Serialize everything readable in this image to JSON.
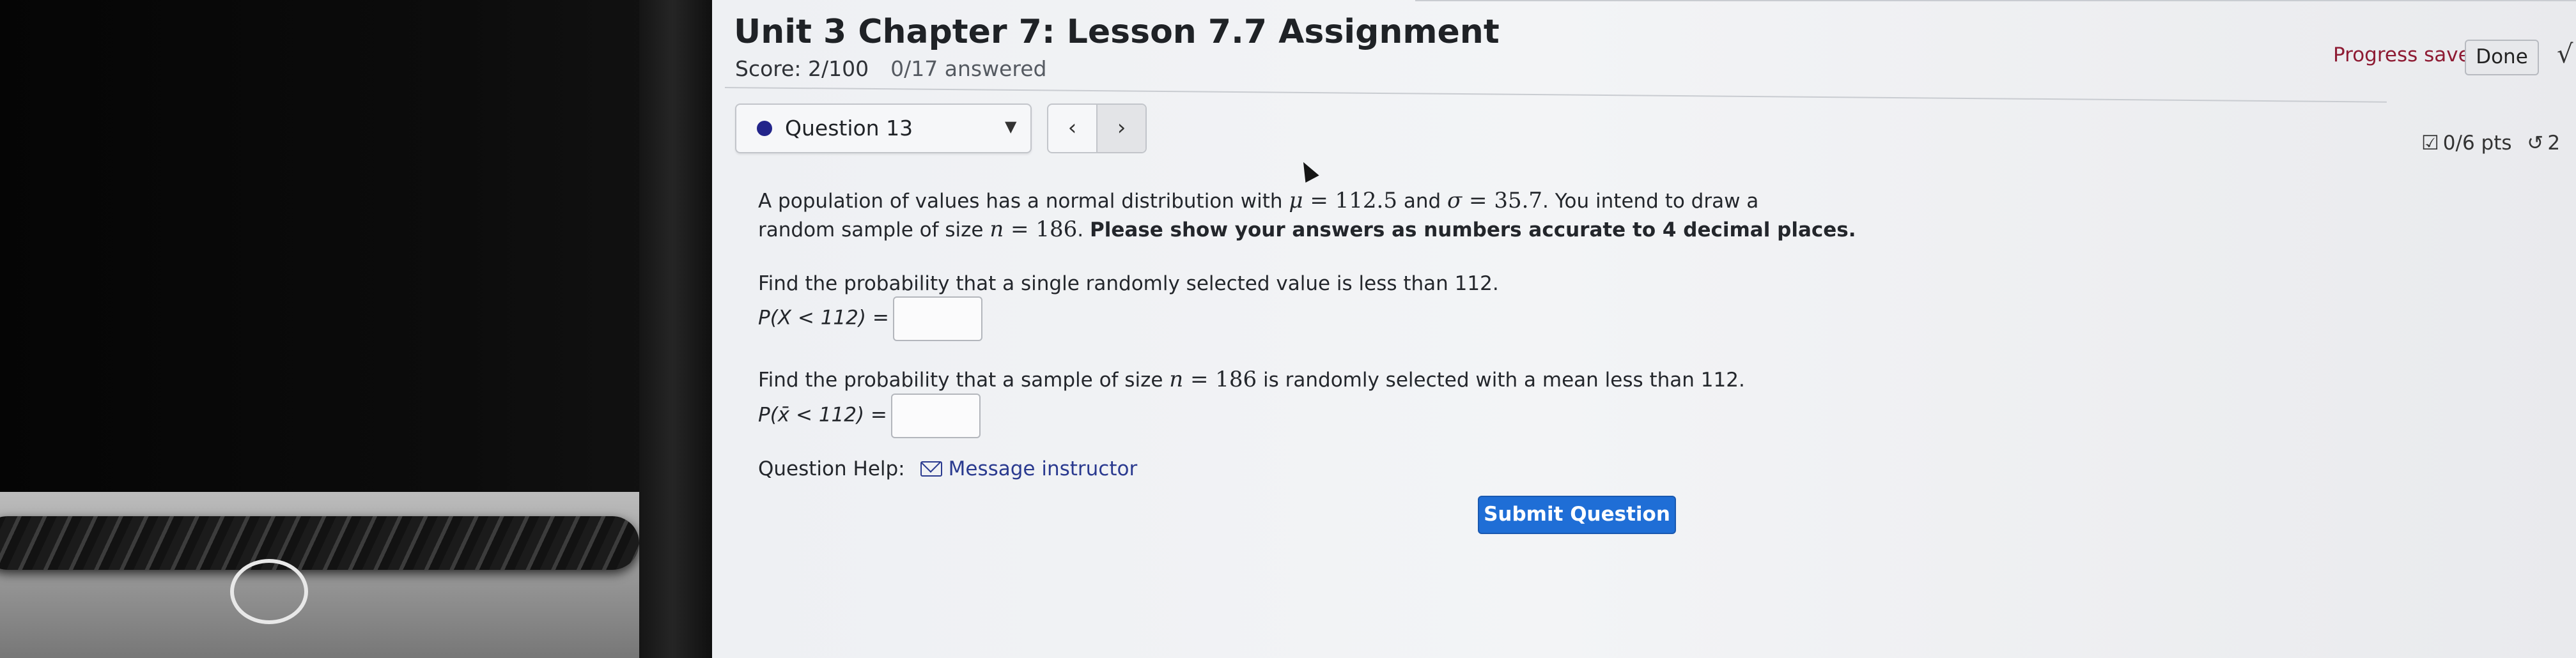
{
  "header": {
    "title": "Unit 3 Chapter 7: Lesson 7.7 Assignment",
    "score": "Score: 2/100",
    "answered": "0/17 answered",
    "progress": "Progress saved",
    "done_label": "Done",
    "edge_glyph": "√"
  },
  "question_nav": {
    "selected": "Question 13",
    "prev_icon": "‹",
    "next_icon": "›",
    "points": "0/6 pts",
    "retries": "2"
  },
  "question": {
    "intro_a": "A population of values has a normal distribution with ",
    "mu_sym": "μ",
    "eq1": " = 112.5",
    "and": " and ",
    "sigma_sym": "σ",
    "eq2": " = 35.7",
    "intro_b": ". You intend to draw a",
    "intro_c": "random sample of size ",
    "n_sym": "n",
    "eq3": " = 186",
    "intro_d": ". ",
    "instruction": "Please show your answers as numbers accurate to 4 decimal places.",
    "part1_prompt": "Find the probability that a single randomly selected value is less than 112.",
    "part1_label": "P(X < 112) =",
    "part2_prompt_a": "Find the probability that a sample of size ",
    "part2_eq": " = 186",
    "part2_prompt_b": " is randomly selected with a mean less than 112.",
    "part2_label": "P(x̄ < 112) =",
    "help_label": "Question Help:",
    "message_label": "Message instructor",
    "submit_label": "Submit Question"
  },
  "inputs": {
    "answer1": "",
    "answer2": ""
  }
}
